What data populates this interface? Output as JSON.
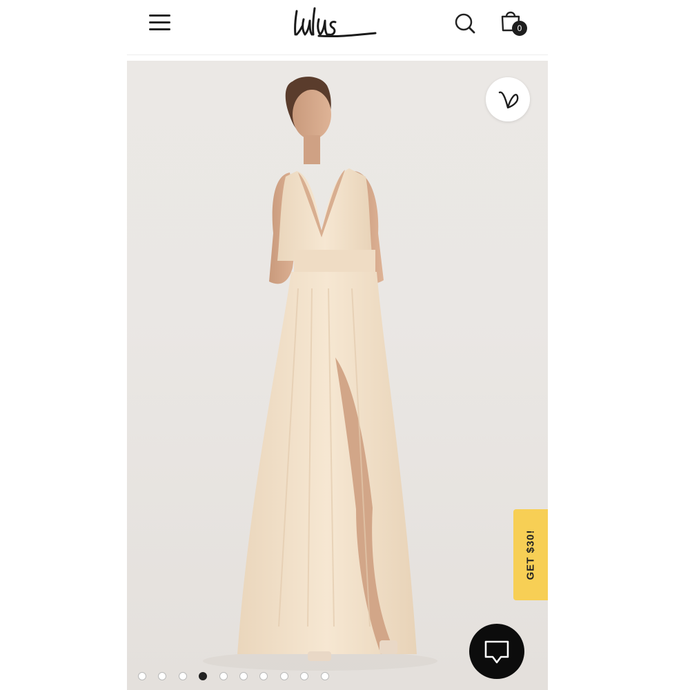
{
  "header": {
    "logo_text": "lulus",
    "menu_icon": "hamburger-menu-icon",
    "search_icon": "search-icon",
    "bag_icon": "shopping-bag-icon",
    "cart_count": "0"
  },
  "product_gallery": {
    "wishlist_icon": "heart-icon",
    "promo_tab_label": "GET $30!",
    "chat_icon": "chat-bubble-icon",
    "slide_count": 10,
    "active_slide_index": 3
  },
  "colors": {
    "promo_yellow": "#f7cf55",
    "chat_black": "#0c0c0c",
    "dress_cream": "#f2e0c8"
  }
}
